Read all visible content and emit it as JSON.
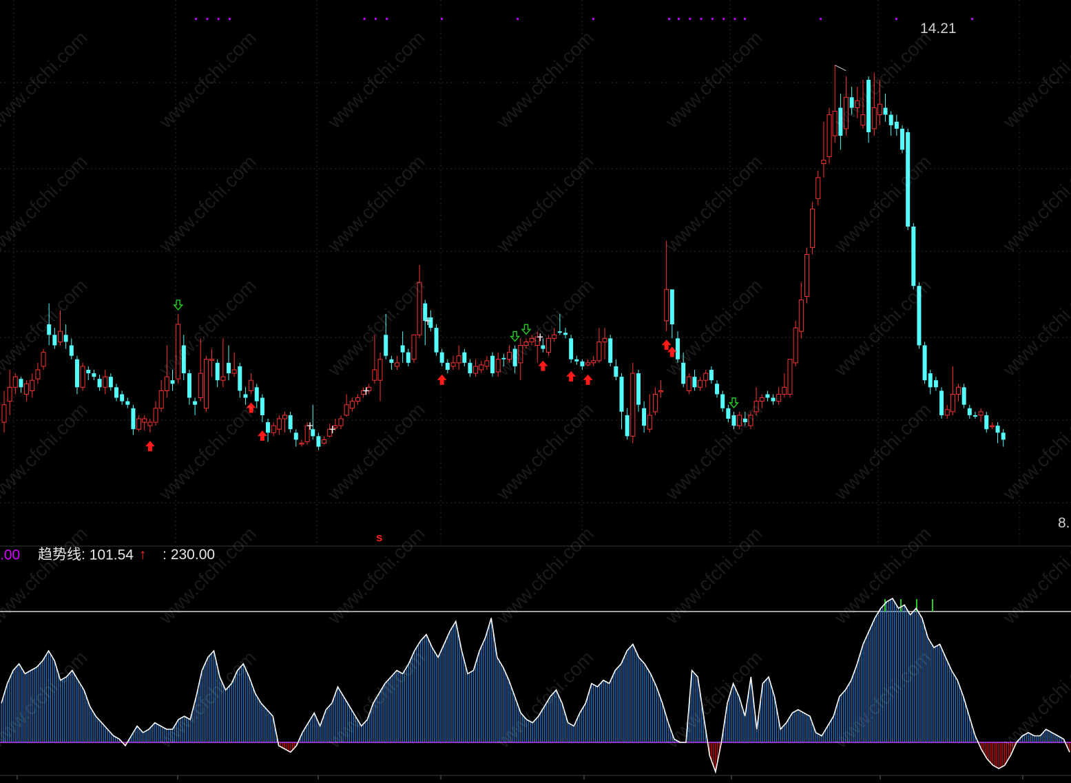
{
  "indicator_header": {
    "value_0": ".00",
    "name": "趋势线:",
    "value_1": "101.54",
    "arrow_glyph": "↑",
    "value_2": ": 230.00"
  },
  "price_labels": {
    "high": "14.21",
    "right_edge": "8."
  },
  "signal_marker": "s",
  "watermark_text": "www.cfchi.com",
  "colors": {
    "background": "#000000",
    "up_candle": "#ff3232",
    "down_candle": "#54fcfc",
    "buy_arrow": "#ff1a1a",
    "sell_arrow": "#22d022",
    "trend_line": "#ffffff",
    "bar_fill": "#2f74c0",
    "negative_bar": "#d01010",
    "overbought_bar": "#22d022",
    "zero_line": "#c040ff",
    "reference_line": "#ffffff",
    "grid": "#2a2a2a",
    "dots": "#c000ff"
  },
  "chart_data": [
    {
      "type": "candlestick",
      "title": "",
      "highlighted_high": 14.21,
      "ylim": [
        7.8,
        14.6
      ],
      "candles": [
        [
          9.1,
          9.35,
          9.55,
          8.95
        ],
        [
          9.4,
          9.6,
          9.85,
          9.2
        ],
        [
          9.6,
          9.75,
          9.8,
          9.5
        ],
        [
          9.72,
          9.6,
          9.75,
          9.52
        ],
        [
          9.5,
          9.65,
          9.7,
          9.4
        ],
        [
          9.55,
          9.7,
          9.8,
          9.45
        ],
        [
          9.72,
          9.85,
          9.95,
          9.65
        ],
        [
          9.9,
          10.1,
          10.15,
          9.85
        ],
        [
          10.5,
          10.35,
          10.8,
          10.2
        ],
        [
          10.35,
          10.2,
          10.45,
          10.15
        ],
        [
          10.25,
          10.4,
          10.7,
          10.2
        ],
        [
          10.35,
          10.25,
          10.5,
          10.15
        ],
        [
          10.2,
          10.05,
          10.3,
          10.0
        ],
        [
          10.0,
          9.6,
          10.05,
          9.5
        ],
        [
          9.6,
          9.9,
          9.95,
          9.55
        ],
        [
          9.85,
          9.8,
          9.9,
          9.7
        ],
        [
          9.8,
          9.75,
          9.85,
          9.7
        ],
        [
          9.72,
          9.6,
          9.78,
          9.55
        ],
        [
          9.6,
          9.75,
          9.85,
          9.5
        ],
        [
          9.75,
          9.6,
          9.8,
          9.55
        ],
        [
          9.6,
          9.45,
          9.65,
          9.4
        ],
        [
          9.5,
          9.4,
          9.55,
          9.35
        ],
        [
          9.4,
          9.35,
          9.45,
          9.3
        ],
        [
          9.3,
          9.0,
          9.35,
          8.92
        ],
        [
          9.0,
          9.15,
          9.2,
          8.97
        ],
        [
          9.1,
          9.15,
          9.2,
          8.98
        ],
        [
          9.05,
          9.1,
          9.15,
          8.95
        ],
        [
          9.1,
          9.3,
          9.4,
          9.05
        ],
        [
          9.3,
          9.55,
          9.7,
          9.25
        ],
        [
          9.55,
          9.75,
          10.2,
          9.45
        ],
        [
          9.7,
          9.65,
          9.85,
          9.55
        ],
        [
          9.72,
          10.5,
          10.65,
          9.65
        ],
        [
          10.2,
          9.8,
          10.35,
          9.7
        ],
        [
          9.8,
          9.45,
          9.85,
          9.35
        ],
        [
          9.4,
          9.35,
          9.45,
          9.2
        ],
        [
          9.45,
          9.8,
          10.3,
          9.4
        ],
        [
          9.3,
          10.0,
          10.05,
          9.25
        ],
        [
          10.0,
          10.0,
          10.15,
          9.75
        ],
        [
          9.95,
          9.7,
          10.0,
          9.6
        ],
        [
          9.7,
          9.75,
          10.3,
          9.6
        ],
        [
          9.95,
          9.8,
          10.2,
          9.7
        ],
        [
          9.8,
          9.85,
          10.1,
          9.75
        ],
        [
          9.9,
          9.55,
          9.95,
          9.45
        ],
        [
          9.5,
          9.45,
          9.6,
          9.35
        ],
        [
          9.55,
          9.7,
          9.8,
          9.5
        ],
        [
          9.6,
          9.4,
          9.65,
          9.3
        ],
        [
          9.45,
          9.2,
          9.5,
          9.1
        ],
        [
          9.1,
          8.95,
          9.15,
          8.82
        ],
        [
          8.95,
          9.05,
          9.1,
          8.9
        ],
        [
          9.0,
          9.15,
          9.2,
          8.92
        ],
        [
          9.15,
          9.2,
          9.25,
          8.95
        ],
        [
          9.2,
          9.0,
          9.25,
          8.95
        ],
        [
          8.95,
          8.85,
          9.0,
          8.75
        ],
        [
          8.8,
          8.8,
          8.85,
          8.75
        ],
        [
          8.82,
          9.05,
          9.1,
          8.78
        ],
        [
          9.0,
          8.9,
          9.35,
          8.85
        ],
        [
          8.9,
          8.75,
          8.95,
          8.7
        ],
        [
          8.8,
          8.85,
          8.9,
          8.78
        ],
        [
          8.9,
          9.0,
          9.08,
          8.88
        ],
        [
          9.02,
          9.05,
          9.15,
          8.98
        ],
        [
          9.05,
          9.15,
          9.2,
          9.0
        ],
        [
          9.2,
          9.35,
          9.5,
          9.18
        ],
        [
          9.3,
          9.4,
          9.45,
          9.25
        ],
        [
          9.4,
          9.45,
          9.5,
          9.35
        ],
        [
          9.5,
          9.55,
          9.6,
          9.45
        ],
        [
          9.55,
          9.6,
          9.65,
          9.5
        ],
        [
          9.7,
          9.85,
          10.35,
          9.65
        ],
        [
          9.7,
          10.0,
          10.1,
          9.4
        ],
        [
          10.35,
          10.05,
          10.65,
          10.0
        ],
        [
          10.0,
          9.95,
          10.05,
          9.85
        ],
        [
          9.9,
          9.95,
          10.05,
          9.85
        ],
        [
          10.2,
          10.1,
          10.4,
          9.95
        ],
        [
          10.1,
          9.95,
          10.15,
          9.9
        ],
        [
          10.0,
          10.35,
          10.35,
          9.95
        ],
        [
          10.35,
          11.1,
          11.35,
          10.3
        ],
        [
          10.8,
          10.55,
          10.85,
          10.2
        ],
        [
          10.6,
          10.45,
          10.7,
          10.4
        ],
        [
          10.45,
          10.1,
          10.5,
          10.05
        ],
        [
          10.1,
          9.95,
          10.15,
          9.9
        ],
        [
          9.95,
          9.85,
          10.0,
          9.8
        ],
        [
          9.9,
          9.95,
          10.05,
          9.85
        ],
        [
          9.95,
          10.05,
          10.2,
          9.85
        ],
        [
          10.1,
          9.95,
          10.15,
          9.9
        ],
        [
          9.95,
          9.8,
          10.0,
          9.75
        ],
        [
          9.8,
          9.9,
          10.0,
          9.75
        ],
        [
          9.85,
          9.92,
          9.98,
          9.8
        ],
        [
          9.9,
          9.98,
          10.05,
          9.85
        ],
        [
          10.05,
          9.8,
          10.1,
          9.75
        ],
        [
          9.82,
          10.0,
          10.1,
          9.75
        ],
        [
          10.02,
          10.0,
          10.08,
          9.9
        ],
        [
          10.0,
          10.1,
          10.2,
          9.95
        ],
        [
          10.15,
          9.9,
          10.2,
          9.8
        ],
        [
          9.95,
          10.2,
          10.3,
          9.7
        ],
        [
          10.2,
          10.25,
          10.3,
          10.15
        ],
        [
          10.25,
          10.3,
          10.35,
          10.2
        ],
        [
          10.2,
          10.32,
          10.4,
          9.95
        ],
        [
          10.2,
          10.15,
          10.3,
          10.1
        ],
        [
          10.1,
          10.3,
          10.35,
          10.05
        ],
        [
          10.3,
          10.35,
          10.45,
          10.25
        ],
        [
          10.4,
          10.38,
          10.65,
          10.35
        ],
        [
          10.38,
          10.35,
          10.45,
          10.3
        ],
        [
          10.3,
          10.0,
          10.35,
          9.95
        ],
        [
          10.0,
          9.97,
          10.05,
          9.92
        ],
        [
          9.97,
          9.9,
          10.0,
          9.85
        ],
        [
          9.92,
          9.95,
          10.0,
          9.9
        ],
        [
          9.95,
          9.98,
          10.05,
          9.9
        ],
        [
          9.98,
          10.25,
          10.45,
          9.95
        ],
        [
          10.25,
          10.3,
          10.45,
          10.0
        ],
        [
          10.3,
          9.95,
          10.35,
          9.9
        ],
        [
          9.9,
          9.75,
          10.0,
          9.7
        ],
        [
          9.75,
          9.25,
          9.8,
          9.0
        ],
        [
          9.2,
          8.9,
          9.3,
          8.85
        ],
        [
          8.9,
          9.8,
          9.95,
          8.8
        ],
        [
          9.8,
          9.35,
          9.85,
          9.25
        ],
        [
          9.3,
          9.05,
          9.4,
          8.95
        ],
        [
          9.0,
          9.2,
          9.5,
          8.95
        ],
        [
          9.25,
          9.5,
          9.6,
          9.2
        ],
        [
          9.55,
          9.55,
          9.7,
          9.45
        ],
        [
          10.55,
          11.0,
          11.7,
          10.4
        ],
        [
          11.0,
          10.5,
          11.0,
          10.3
        ],
        [
          10.3,
          10.0,
          10.4,
          9.95
        ],
        [
          9.95,
          9.65,
          10.1,
          9.6
        ],
        [
          9.55,
          9.75,
          9.8,
          9.5
        ],
        [
          9.75,
          9.6,
          9.85,
          9.55
        ],
        [
          9.6,
          9.7,
          9.75,
          9.55
        ],
        [
          9.7,
          9.8,
          9.85,
          9.6
        ],
        [
          9.85,
          9.7,
          9.9,
          9.65
        ],
        [
          9.65,
          9.5,
          9.7,
          9.45
        ],
        [
          9.5,
          9.3,
          9.55,
          9.25
        ],
        [
          9.3,
          9.15,
          9.35,
          9.1
        ],
        [
          9.2,
          9.05,
          9.25,
          9.0
        ],
        [
          9.05,
          9.2,
          9.25,
          9.0
        ],
        [
          9.15,
          9.1,
          9.25,
          9.05
        ],
        [
          9.05,
          9.2,
          9.25,
          9.0
        ],
        [
          9.25,
          9.4,
          9.6,
          9.2
        ],
        [
          9.4,
          9.45,
          9.5,
          9.3
        ],
        [
          9.5,
          9.45,
          9.55,
          9.4
        ],
        [
          9.45,
          9.4,
          9.5,
          9.35
        ],
        [
          9.4,
          9.5,
          9.6,
          9.35
        ],
        [
          9.5,
          9.6,
          9.8,
          9.45
        ],
        [
          9.5,
          10.0,
          10.0,
          9.45
        ],
        [
          9.95,
          10.45,
          10.55,
          9.9
        ],
        [
          10.4,
          10.85,
          11.1,
          10.3
        ],
        [
          10.9,
          11.5,
          11.6,
          10.8
        ],
        [
          11.6,
          12.15,
          12.25,
          11.5
        ],
        [
          12.3,
          12.6,
          12.7,
          12.2
        ],
        [
          12.8,
          12.85,
          13.4,
          12.6
        ],
        [
          12.9,
          13.5,
          13.6,
          12.8
        ],
        [
          13.2,
          13.55,
          14.21,
          13.1
        ],
        [
          13.6,
          13.2,
          13.8,
          13.0
        ],
        [
          13.3,
          13.75,
          14.05,
          13.2
        ],
        [
          13.75,
          13.6,
          13.9,
          13.5
        ],
        [
          13.6,
          13.7,
          13.9,
          13.45
        ],
        [
          13.35,
          13.5,
          14.0,
          13.3
        ],
        [
          14.0,
          13.25,
          14.05,
          13.1
        ],
        [
          13.3,
          13.6,
          14.1,
          13.2
        ],
        [
          13.5,
          13.65,
          14.0,
          13.35
        ],
        [
          13.6,
          13.5,
          13.8,
          13.4
        ],
        [
          13.5,
          13.35,
          13.55,
          13.2
        ],
        [
          13.4,
          13.3,
          13.5,
          13.2
        ],
        [
          13.3,
          13.0,
          13.35,
          12.95
        ],
        [
          13.25,
          11.9,
          13.3,
          11.85
        ],
        [
          11.9,
          11.05,
          11.95,
          11.0
        ],
        [
          11.05,
          10.2,
          11.1,
          10.15
        ],
        [
          10.2,
          9.7,
          10.25,
          9.65
        ],
        [
          9.8,
          9.6,
          9.85,
          9.5
        ],
        [
          9.7,
          9.6,
          9.75,
          9.55
        ],
        [
          9.55,
          9.2,
          9.6,
          9.15
        ],
        [
          9.2,
          9.28,
          9.35,
          9.15
        ],
        [
          9.25,
          9.5,
          9.9,
          9.2
        ],
        [
          9.5,
          9.6,
          9.65,
          9.4
        ],
        [
          9.6,
          9.35,
          9.65,
          9.3
        ],
        [
          9.3,
          9.2,
          9.35,
          9.15
        ],
        [
          9.2,
          9.18,
          9.25,
          9.15
        ],
        [
          9.2,
          9.25,
          9.3,
          9.1
        ],
        [
          9.2,
          9.0,
          9.25,
          8.95
        ],
        [
          9.05,
          9.05,
          9.1,
          9.0
        ],
        [
          9.05,
          8.95,
          9.1,
          8.8
        ],
        [
          8.95,
          8.85,
          9.0,
          8.75
        ]
      ],
      "buy_signal_bars": [
        26,
        44,
        46,
        78,
        96,
        101,
        104,
        118,
        119
      ],
      "sell_signal_bars": [
        31,
        91,
        93,
        130
      ],
      "x_plus_bars": [
        54,
        58,
        64,
        75,
        95
      ],
      "tick_dot_groups": [
        [
          34,
          40
        ],
        [
          64,
          68
        ],
        [
          120,
          130
        ]
      ]
    },
    {
      "type": "bar",
      "series": [
        {
          "name": "趋势线",
          "values": [
            60,
            90,
            110,
            120,
            105,
            110,
            115,
            125,
            140,
            125,
            95,
            100,
            110,
            95,
            80,
            55,
            40,
            30,
            20,
            10,
            5,
            -5,
            10,
            25,
            15,
            20,
            30,
            25,
            20,
            20,
            35,
            40,
            35,
            70,
            110,
            130,
            140,
            100,
            80,
            90,
            110,
            120,
            100,
            75,
            60,
            50,
            40,
            -5,
            -10,
            -15,
            -5,
            15,
            30,
            45,
            25,
            50,
            60,
            85,
            70,
            55,
            40,
            25,
            35,
            60,
            75,
            90,
            100,
            110,
            105,
            120,
            140,
            155,
            165,
            145,
            130,
            150,
            170,
            185,
            140,
            105,
            110,
            140,
            160,
            190,
            130,
            115,
            95,
            70,
            45,
            35,
            30,
            40,
            55,
            70,
            80,
            60,
            30,
            25,
            45,
            60,
            90,
            85,
            95,
            90,
            110,
            120,
            140,
            150,
            130,
            120,
            105,
            85,
            60,
            30,
            5,
            0,
            0,
            110,
            100,
            40,
            -20,
            -45,
            0,
            60,
            90,
            70,
            40,
            100,
            20,
            90,
            100,
            70,
            20,
            30,
            45,
            50,
            45,
            40,
            15,
            10,
            25,
            40,
            70,
            80,
            95,
            120,
            150,
            170,
            190,
            205,
            215,
            220,
            205,
            210,
            195,
            205,
            190,
            160,
            145,
            150,
            130,
            110,
            95,
            70,
            40,
            10,
            -10,
            -25,
            -35,
            -40,
            -35,
            -20,
            0,
            10,
            15,
            10,
            10,
            20,
            15,
            10,
            5,
            -15
          ]
        }
      ],
      "overbought_level": 200,
      "overbought_peaks": [
        13,
        14,
        15,
        16
      ]
    }
  ]
}
